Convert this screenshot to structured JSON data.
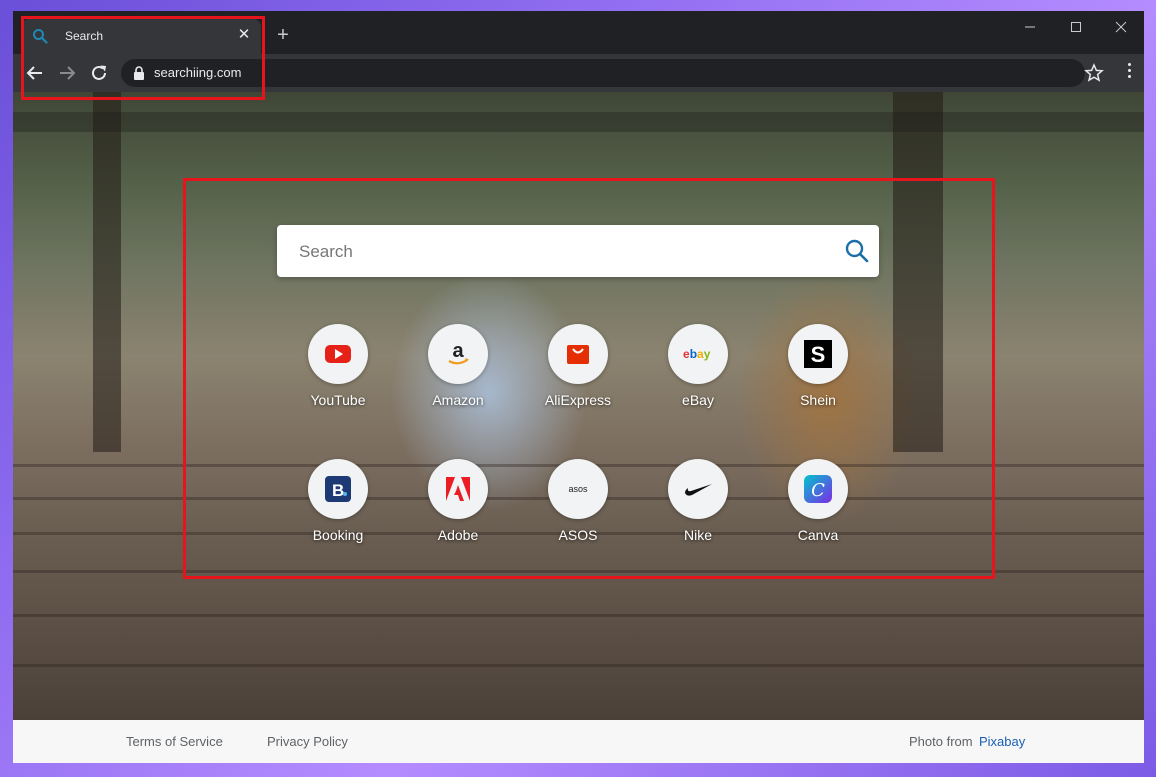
{
  "browser": {
    "tab_title": "Search",
    "url": "searchiing.com",
    "new_tab_symbol": "+",
    "close_tab_symbol": "✕"
  },
  "search": {
    "placeholder": "Search"
  },
  "shortcuts": [
    {
      "label": "YouTube",
      "icon": "youtube-icon"
    },
    {
      "label": "Amazon",
      "icon": "amazon-icon"
    },
    {
      "label": "AliExpress",
      "icon": "aliexpress-icon"
    },
    {
      "label": "eBay",
      "icon": "ebay-icon"
    },
    {
      "label": "Shein",
      "icon": "shein-icon"
    },
    {
      "label": "Booking",
      "icon": "booking-icon"
    },
    {
      "label": "Adobe",
      "icon": "adobe-icon"
    },
    {
      "label": "ASOS",
      "icon": "asos-icon"
    },
    {
      "label": "Nike",
      "icon": "nike-icon"
    },
    {
      "label": "Canva",
      "icon": "canva-icon"
    }
  ],
  "footer": {
    "terms": "Terms of Service",
    "privacy": "Privacy Policy",
    "photo_prefix": "Photo from",
    "photo_source": "Pixabay"
  },
  "colors": {
    "accent_blue": "#1a6fa8",
    "highlight_red": "#e8141c"
  }
}
